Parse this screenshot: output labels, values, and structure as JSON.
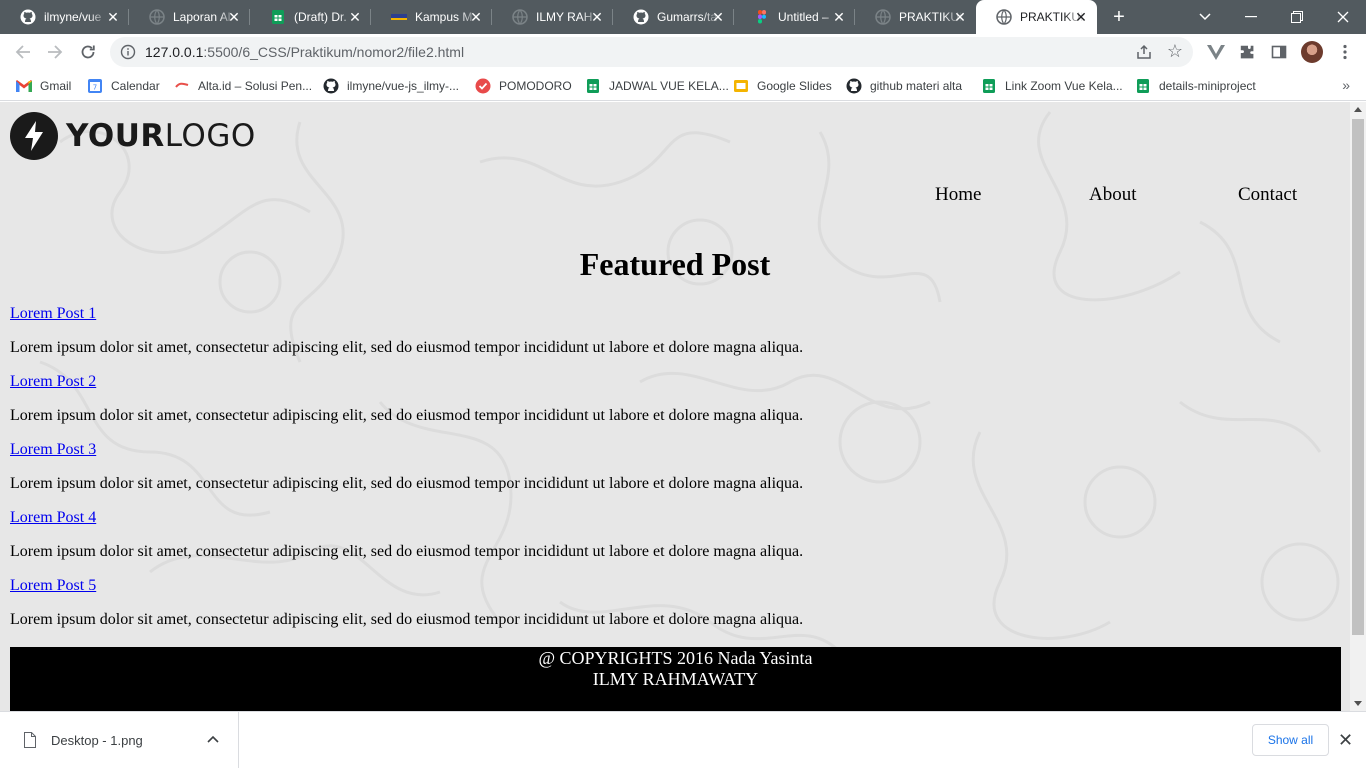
{
  "browser": {
    "tabs": [
      {
        "title": "ilmyne/vue-js",
        "icon": "github-icon"
      },
      {
        "title": "Laporan Akhir",
        "icon": "globe-icon"
      },
      {
        "title": "(Draft) Drive",
        "icon": "google-sheets-icon"
      },
      {
        "title": "Kampus Merdeka",
        "icon": "kampus-merdeka-icon"
      },
      {
        "title": "ILMY RAHMAWATY",
        "icon": "globe-icon"
      },
      {
        "title": "Gumarrs/task",
        "icon": "github-icon"
      },
      {
        "title": "Untitled – Figma",
        "icon": "figma-icon"
      },
      {
        "title": "PRAKTIKUM",
        "icon": "globe-icon"
      },
      {
        "title": "PRAKTIKUM",
        "icon": "globe-icon",
        "active": true
      }
    ],
    "visible_tab_titles": [
      "ilmyne/vue",
      "Laporan Al",
      "(Draft) Dr.",
      "Kampus M",
      "ILMY RAH",
      "Gumarrs/ta",
      "Untitled –",
      "PRAKTIKUI",
      "PRAKTIKUI"
    ],
    "new_tab_label": "+",
    "address": {
      "host": "127.0.0.1",
      "path": ":5500/6_CSS/Praktikum/nomor2/file2.html"
    },
    "bookmarks": [
      {
        "label": "Gmail",
        "icon": "gmail-icon"
      },
      {
        "label": "Calendar",
        "icon": "calendar-icon"
      },
      {
        "label": "Alta.id – Solusi Pen...",
        "icon": "alta-icon"
      },
      {
        "label": "ilmyne/vue-js_ilmy-...",
        "icon": "github-icon"
      },
      {
        "label": "POMODORO",
        "icon": "pomodoro-icon"
      },
      {
        "label": "JADWAL VUE KELA...",
        "icon": "google-sheets-icon"
      },
      {
        "label": "Google Slides",
        "icon": "google-slides-icon"
      },
      {
        "label": "github materi alta",
        "icon": "github-icon"
      },
      {
        "label": "Link Zoom Vue Kela...",
        "icon": "google-sheets-icon"
      },
      {
        "label": "details-miniproject",
        "icon": "google-sheets-icon"
      }
    ],
    "bookmarks_overflow": "»"
  },
  "page": {
    "logo": {
      "bold": "YOUR",
      "light": "LOGO"
    },
    "nav": {
      "home": "Home",
      "about": "About",
      "contact": "Contact"
    },
    "heading": "Featured Post",
    "posts": [
      {
        "title": "Lorem Post 1",
        "text": "Lorem ipsum dolor sit amet, consectetur adipiscing elit, sed do eiusmod tempor incididunt ut labore et dolore magna aliqua."
      },
      {
        "title": "Lorem Post 2",
        "text": "Lorem ipsum dolor sit amet, consectetur adipiscing elit, sed do eiusmod tempor incididunt ut labore et dolore magna aliqua."
      },
      {
        "title": "Lorem Post 3",
        "text": "Lorem ipsum dolor sit amet, consectetur adipiscing elit, sed do eiusmod tempor incididunt ut labore et dolore magna aliqua."
      },
      {
        "title": "Lorem Post 4",
        "text": "Lorem ipsum dolor sit amet, consectetur adipiscing elit, sed do eiusmod tempor incididunt ut labore et dolore magna aliqua."
      },
      {
        "title": "Lorem Post 5",
        "text": "Lorem ipsum dolor sit amet, consectetur adipiscing elit, sed do eiusmod tempor incididunt ut labore et dolore magna aliqua."
      }
    ],
    "footer": {
      "line1": "@ COPYRIGHTS 2016 Nada Yasinta",
      "line2": "ILMY RAHMAWATY"
    }
  },
  "downloads": {
    "file_name": "Desktop - 1.png",
    "show_all": "Show all"
  },
  "colors": {
    "tabstrip": "#525a5f",
    "page_background": "#e7e7e7",
    "link": "#0000ee",
    "footer": "#000000",
    "accent": "#1a73e8"
  }
}
